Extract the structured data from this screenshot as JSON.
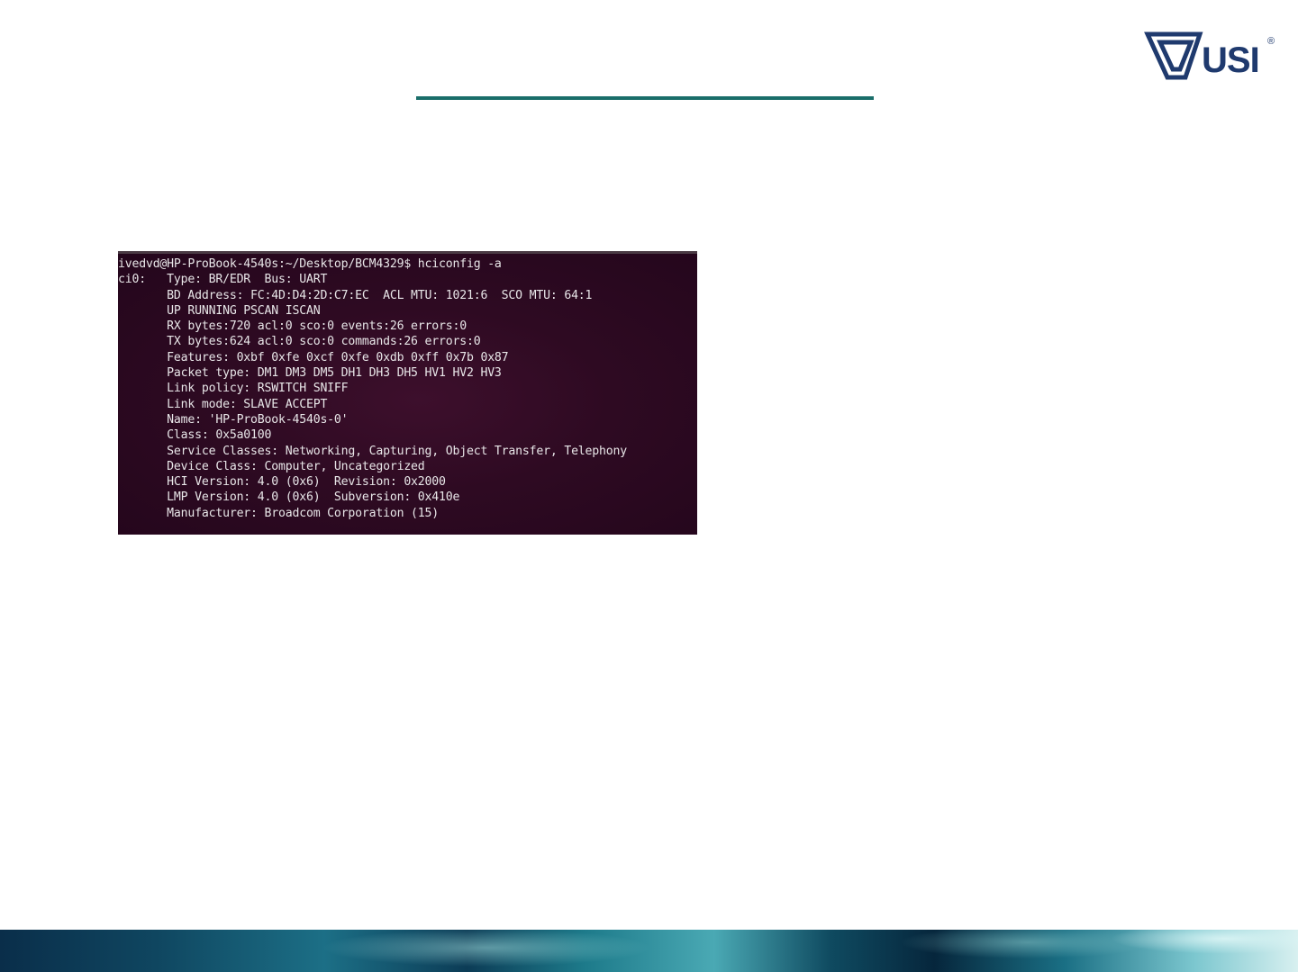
{
  "logo": {
    "text": "USI",
    "registered": "®"
  },
  "colors": {
    "accent_rule": "#1a6e6a",
    "logo_navy": "#1f3a6e",
    "terminal_bg": "#2e0a22",
    "terminal_text": "#e8e6e8"
  },
  "terminal": {
    "lines": [
      "ivedvd@HP-ProBook-4540s:~/Desktop/BCM4329$ hciconfig -a",
      "ci0:   Type: BR/EDR  Bus: UART",
      "       BD Address: FC:4D:D4:2D:C7:EC  ACL MTU: 1021:6  SCO MTU: 64:1",
      "       UP RUNNING PSCAN ISCAN",
      "       RX bytes:720 acl:0 sco:0 events:26 errors:0",
      "       TX bytes:624 acl:0 sco:0 commands:26 errors:0",
      "       Features: 0xbf 0xfe 0xcf 0xfe 0xdb 0xff 0x7b 0x87",
      "       Packet type: DM1 DM3 DM5 DH1 DH3 DH5 HV1 HV2 HV3",
      "       Link policy: RSWITCH SNIFF",
      "       Link mode: SLAVE ACCEPT",
      "       Name: 'HP-ProBook-4540s-0'",
      "       Class: 0x5a0100",
      "       Service Classes: Networking, Capturing, Object Transfer, Telephony",
      "       Device Class: Computer, Uncategorized",
      "       HCI Version: 4.0 (0x6)  Revision: 0x2000",
      "       LMP Version: 4.0 (0x6)  Subversion: 0x410e",
      "       Manufacturer: Broadcom Corporation (15)"
    ]
  }
}
